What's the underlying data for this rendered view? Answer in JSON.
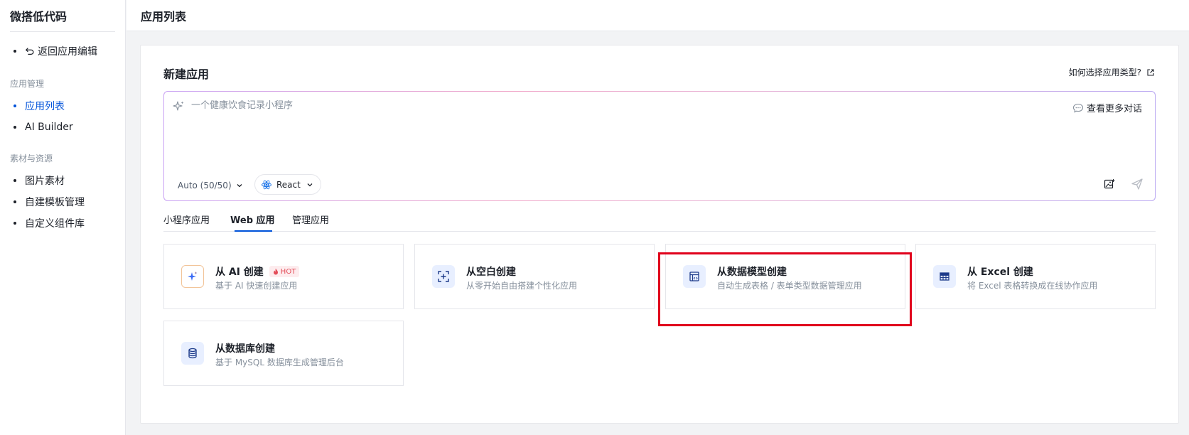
{
  "sidebar": {
    "brand": "微搭低代码",
    "back": "返回应用编辑",
    "group_app": "应用管理",
    "app_items": [
      "应用列表",
      "AI Builder"
    ],
    "group_assets": "素材与资源",
    "asset_items": [
      "图片素材",
      "自建模板管理",
      "自定义组件库"
    ]
  },
  "header": {
    "title": "应用列表"
  },
  "card": {
    "title": "新建应用",
    "help_link": "如何选择应用类型?",
    "prompt": {
      "placeholder": "一个健康饮食记录小程序",
      "more_conversations": "查看更多对话",
      "model": "Auto (50/50)",
      "framework": "React"
    },
    "tabs": [
      "小程序应用",
      "Web 应用",
      "管理应用"
    ],
    "active_tab": "Web 应用",
    "templates": [
      {
        "title": "从 AI 创建",
        "badge": "HOT",
        "desc": "基于 AI 快速创建应用",
        "icon": "sparkle-icon"
      },
      {
        "title": "从空白创建",
        "desc": "从零开始自由搭建个性化应用",
        "icon": "blank-create-icon"
      },
      {
        "title": "从数据模型创建",
        "desc": "自动生成表格 / 表单类型数据管理应用",
        "icon": "data-model-icon"
      },
      {
        "title": "从 Excel 创建",
        "desc": "将 Excel 表格转换成在线协作应用",
        "icon": "table-icon"
      },
      {
        "title": "从数据库创建",
        "desc": "基于 MySQL 数据库生成管理后台",
        "icon": "database-icon"
      }
    ]
  },
  "colors": {
    "accent": "#0052d9",
    "hot": "#e34d59",
    "highlight": "#e0001b"
  }
}
